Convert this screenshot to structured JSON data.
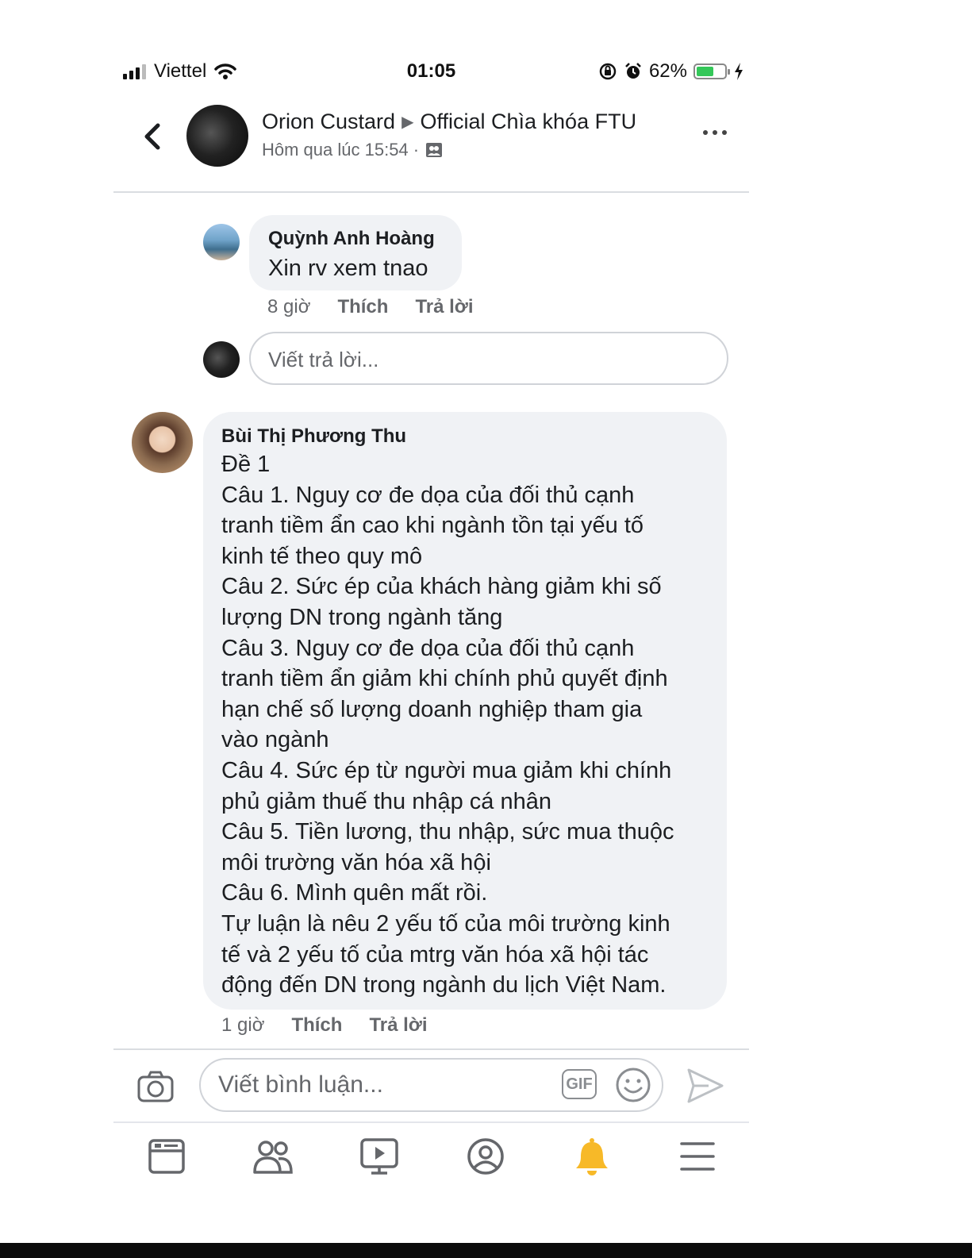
{
  "status_bar": {
    "carrier": "Viettel",
    "time": "01:05",
    "battery_percent": "62%",
    "battery_level": 0.62,
    "battery_color": "#34c759"
  },
  "header": {
    "author": "Orion Custard",
    "group": "Official Chìa khóa FTU",
    "timestamp": "Hôm qua lúc 15:54 ·",
    "icons": {
      "back": "chevron-left-icon",
      "privacy": "group-icon",
      "more": "more-icon"
    }
  },
  "comments": [
    {
      "name": "Quỳnh Anh Hoàng",
      "text": "Xin rv xem tnao",
      "time": "8 giờ",
      "like": "Thích",
      "reply": "Trả lời"
    },
    {
      "name": "Bùi Thị Phương Thu",
      "text": "Đề 1\nCâu 1. Nguy cơ đe dọa của đối thủ cạnh\ntranh tiềm ẩn cao khi ngành tồn tại yếu tố\nkinh tế theo quy mô\nCâu 2. Sức ép của khách hàng giảm khi số\nlượng DN trong ngành tăng\nCâu 3. Nguy cơ đe dọa của đối thủ cạnh\ntranh tiềm ẩn giảm khi chính phủ quyết định\nhạn chế số lượng doanh nghiệp tham gia\nvào ngành\nCâu 4. Sức ép từ người mua giảm khi chính\nphủ giảm thuế thu nhập cá nhân\nCâu 5. Tiền lương, thu nhập, sức mua thuộc\nmôi trường văn hóa xã hội\nCâu 6. Mình quên mất rồi.\nTự luận là nêu 2 yếu tố của môi trường kinh\ntế và 2 yếu tố của mtrg văn hóa xã hội tác\nđộng đến DN trong ngành du lịch Việt Nam.",
      "time": "1 giờ",
      "like": "Thích",
      "reply": "Trả lời"
    }
  ],
  "reply_input": {
    "placeholder": "Viết trả lời..."
  },
  "composer": {
    "placeholder": "Viết bình luận...",
    "gif_label": "GIF",
    "icons": [
      "camera-icon",
      "gif-icon",
      "emoji-icon",
      "send-icon"
    ]
  },
  "tab_bar": {
    "tabs": [
      "news-feed-icon",
      "friends-icon",
      "watch-icon",
      "profile-icon",
      "notifications-icon",
      "menu-icon"
    ],
    "active_tab": "notifications-icon",
    "active_color": "#f7b928"
  }
}
